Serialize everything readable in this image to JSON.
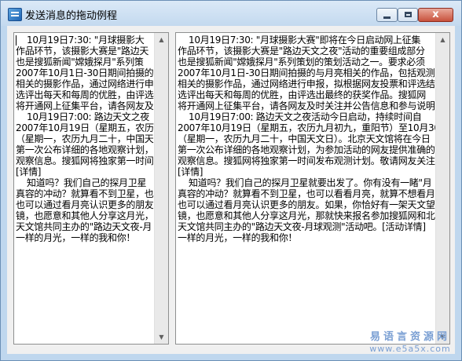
{
  "window": {
    "title": "发送消息的拖动例程",
    "minimize_label": "",
    "maximize_label": "",
    "close_label": "x"
  },
  "left_pane": {
    "text": "    10月19日7:30: \"月球摄影大\n作品环节，该摄影大赛是\"路边天\n也是搜狐新闻\"嫦娥探月\"系列策\n2007年10月1日-30日期间拍摄的与\n相关的摄影作品，通过网络进行申\n选评出每天和每周的优胜，由评选\n将开通网上征集平台，请各网友及\n    10月19日7:00: 路边天文之夜\n2007年10月19日（星期五，农历九\n（星期一，农历九月二十，中国天\n第一次公布详细的各地观察计划，\n观察信息。搜狐网将独家第一时间\n[详情]\n    知道吗？我们自己的探月卫星\n真容的冲动？就算看不到卫星，也\n也可以通过看月亮认识更多的朋友\n镜，也愿意和其他人分享这月光，\n天文馆共同主办的\"路边天文夜-月\n一样的月光，一样的我和你！"
  },
  "right_pane": {
    "text": "    10月19日7:30: \"月球摄影大赛\"即将在今日启动网上征集\n作品环节，该摄影大赛是\"路边天文之夜\"活动的重要组成部分\n也是搜狐新闻\"嫦娥探月\"系列策划的策划活动之一。要求必须\n2007年10月1日-30日期间拍摄的与月亮相关的作品，包括观测活\n相关的摄影作品，通过网络进行申报，拟根据网友投票和评选结\n选评出每天和每周的优胜，由评选出最终的获奖作品。搜狐网\n将开通网上征集平台，请各网友及时关注并公告信息和参与说明\n    10月19日7:00: 路边天文之夜活动今日启动，持续时间自\n2007年10月19日（星期五，农历九月初九，重阳节）至10月30日\n（星期一，农历九月二十，中国天文日）。北京天文馆将在今日\n第一次公布详细的各地观察计划，为参加活动的网友提供准确的\n观察信息。搜狐网将独家第一时间发布观测计划。敬请网友关注\n[详情]\n    知道吗？我们自己的探月卫星就要出发了。你有没有一睹\"月\n真容的冲动？就算看不到卫星，也可以看看月亮，就算不想看月\n也可以通过看月亮认识更多的朋友。如果，你恰好有一架天文望\n镜，也愿意和其他人分享这月光，那就快来报名参加搜狐网和北京\n天文馆共同主办的\"路边天文夜-月球观测\"活动吧。[活动详情]\n一样的月光，一样的我和你！"
  },
  "watermark": {
    "site_name": "易语言资源网",
    "url": "www.e5a5x.com"
  },
  "colors": {
    "frame": "#bfd7ee",
    "client": "#f0f0f0",
    "watermark": "#7a9fd3",
    "close_button": "#c8513c"
  },
  "icons": {
    "app": "app-window-icon",
    "scroll_up": "chevron-up-icon",
    "scroll_down": "chevron-down-icon"
  }
}
